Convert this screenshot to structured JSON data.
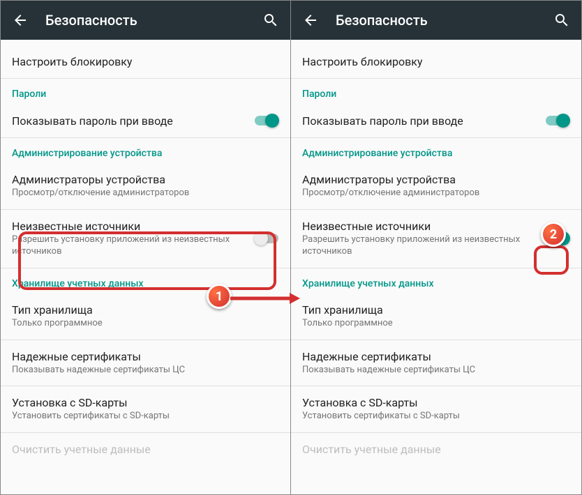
{
  "header": {
    "title": "Безопасность"
  },
  "cutoff": "Настроить блокировку",
  "sections": {
    "passwords": "Пароли",
    "device_admin": "Администрирование устройства",
    "cred_storage": "Хранилище учетных данных"
  },
  "items": {
    "show_password": "Показывать пароль при вводе",
    "device_admins": {
      "title": "Администраторы устройства",
      "sub": "Просмотр/отключение администраторов"
    },
    "unknown_sources": {
      "title": "Неизвестные источники",
      "sub": "Разрешить установку приложений из неизвестных источников"
    },
    "storage_type": {
      "title": "Тип хранилища",
      "sub": "Только программное"
    },
    "trusted_certs": {
      "title": "Надежные сертификаты",
      "sub": "Показывать надежные сертификаты ЦС"
    },
    "install_sd": {
      "title": "Установка с SD-карты",
      "sub": "Установить сертификаты с SD-карты"
    },
    "clear_creds": "Очистить учетные данные"
  },
  "badges": {
    "one": "1",
    "two": "2"
  }
}
